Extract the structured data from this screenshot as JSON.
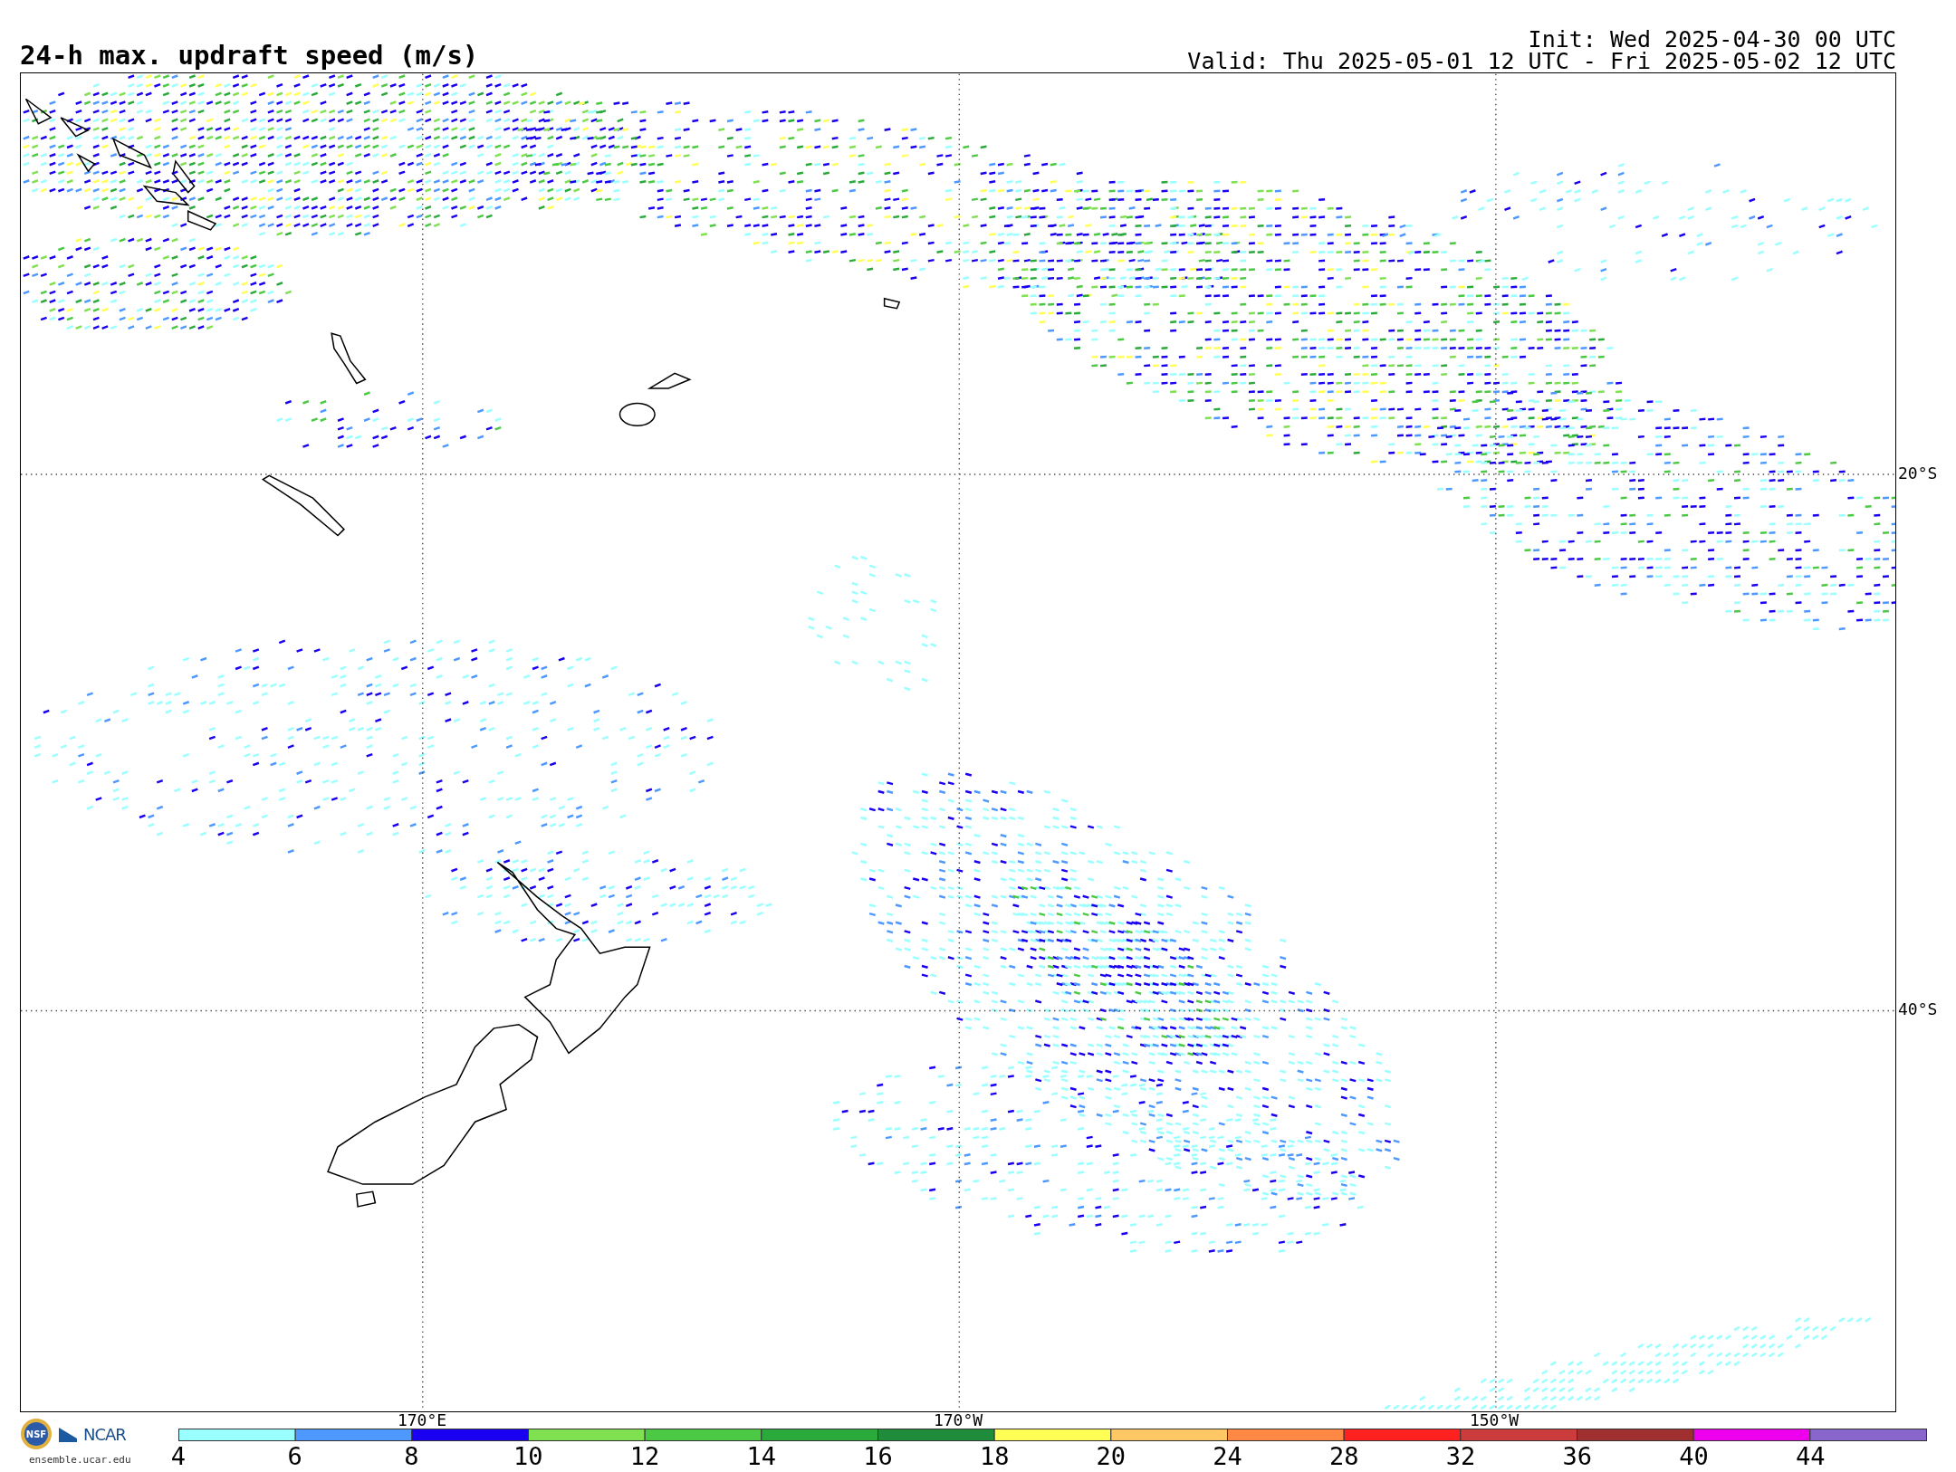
{
  "title": "24-h max. updraft speed (m/s)",
  "init": "Init: Wed 2025-04-30 00 UTC",
  "valid": "Valid: Thu 2025-05-01 12 UTC - Fri 2025-05-02 12 UTC",
  "map": {
    "latitude_labels": [
      "20°S",
      "40°S"
    ],
    "longitude_labels": [
      "170°E",
      "170°W",
      "150°W"
    ]
  },
  "logos": {
    "nsf": "NSF",
    "ncar": "NCAR",
    "website": "ensemble.ucar.edu"
  },
  "colorbar": [
    {
      "label": "4",
      "color": "#99ffff"
    },
    {
      "label": "6",
      "color": "#4d99ff"
    },
    {
      "label": "8",
      "color": "#1a00f0"
    },
    {
      "label": "10",
      "color": "#7fe050"
    },
    {
      "label": "12",
      "color": "#4cc944"
    },
    {
      "label": "14",
      "color": "#2aaa3a"
    },
    {
      "label": "16",
      "color": "#1e8c3a"
    },
    {
      "label": "18",
      "color": "#ffff55"
    },
    {
      "label": "20",
      "color": "#ffc864"
    },
    {
      "label": "24",
      "color": "#ff8844"
    },
    {
      "label": "28",
      "color": "#ff2020"
    },
    {
      "label": "32",
      "color": "#cc3c3c"
    },
    {
      "label": "36",
      "color": "#a03030"
    },
    {
      "label": "40",
      "color": "#ee00ee"
    },
    {
      "label": "44",
      "color": "#8866cc"
    }
  ]
}
